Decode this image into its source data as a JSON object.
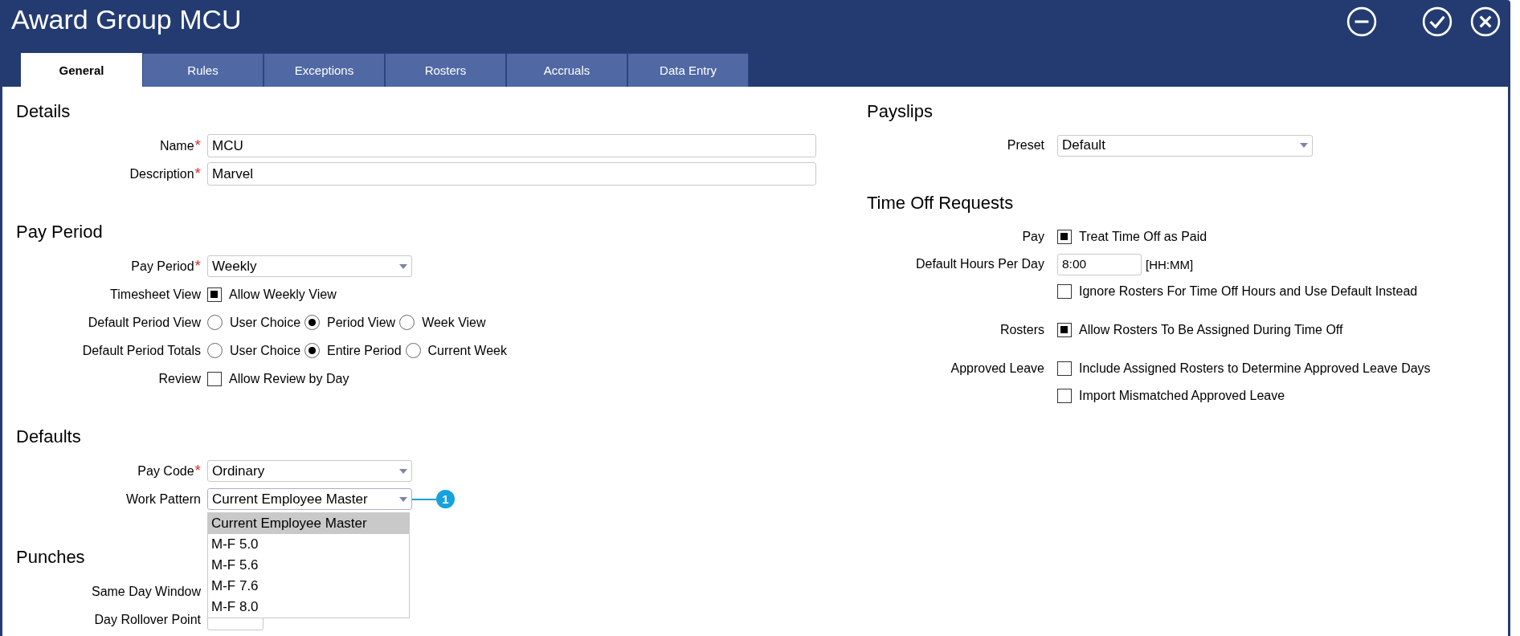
{
  "window": {
    "title": "Award Group MCU",
    "buttons": [
      {
        "kind": "minimize"
      },
      {
        "kind": "confirm"
      },
      {
        "kind": "close"
      }
    ]
  },
  "tabs": [
    {
      "label": "General",
      "selected": true
    },
    {
      "label": "Rules",
      "selected": false
    },
    {
      "label": "Exceptions",
      "selected": false
    },
    {
      "label": "Rosters",
      "selected": false
    },
    {
      "label": "Accruals",
      "selected": false
    },
    {
      "label": "Data Entry",
      "selected": false
    }
  ],
  "left_sections": [
    {
      "heading": "Details",
      "groups": [
        [
          {
            "kind": "text",
            "label": "Name",
            "required_mark": "*",
            "value": "MCU"
          },
          {
            "kind": "text",
            "label": "Description",
            "required_mark": "*",
            "value": "Marvel"
          }
        ]
      ]
    },
    {
      "heading": "Pay Period",
      "groups": [
        [
          {
            "kind": "select",
            "label": "Pay Period",
            "required_mark": "*",
            "value": "Weekly"
          },
          {
            "kind": "checkbox",
            "label": "Timesheet View",
            "options": [
              {
                "text": "Allow Weekly View",
                "checked": true
              }
            ]
          },
          {
            "kind": "radio",
            "label": "Default Period View",
            "options": [
              {
                "text": "User Choice",
                "selected": false
              },
              {
                "text": "Period View",
                "selected": true
              },
              {
                "text": "Week View",
                "selected": false
              }
            ]
          },
          {
            "kind": "radio",
            "label": "Default Period Totals",
            "options": [
              {
                "text": "User Choice",
                "selected": false
              },
              {
                "text": "Entire Period",
                "selected": true
              },
              {
                "text": "Current Week",
                "selected": false
              }
            ]
          },
          {
            "kind": "checkbox",
            "label": "Review",
            "options": [
              {
                "text": "Allow Review by Day",
                "checked": false
              }
            ]
          }
        ]
      ]
    },
    {
      "heading": "Defaults",
      "groups": [
        [
          {
            "kind": "select",
            "label": "Pay Code",
            "required_mark": "*",
            "value": "Ordinary"
          },
          {
            "kind": "select",
            "label": "Work Pattern",
            "value": "Current Employee Master",
            "expanded": true,
            "callout": "1",
            "options": [
              {
                "text": "Current Employee Master",
                "selected": true
              },
              {
                "text": "M-F 5.0",
                "selected": false
              },
              {
                "text": "M-F 5.6",
                "selected": false
              },
              {
                "text": "M-F 7.6",
                "selected": false
              },
              {
                "text": "M-F 8.0",
                "selected": false
              }
            ]
          }
        ]
      ]
    },
    {
      "heading": "Punches",
      "groups": [
        [
          {
            "kind": "label",
            "label": "Same Day Window"
          },
          {
            "kind": "time",
            "label": "Day Rollover Point"
          }
        ]
      ]
    }
  ],
  "right_sections": [
    {
      "heading": "Payslips",
      "groups": [
        [
          {
            "kind": "select",
            "label": "Preset",
            "value": "Default"
          }
        ]
      ]
    },
    {
      "heading": "Time Off Requests",
      "groups": [
        [
          {
            "kind": "checkbox",
            "label": "Pay",
            "options": [
              {
                "text": "Treat Time Off as Paid",
                "checked": true
              }
            ]
          },
          {
            "kind": "time",
            "label": "Default Hours Per Day",
            "value": "8:00",
            "unit": "[HH:MM]"
          },
          {
            "kind": "checkbox",
            "options": [
              {
                "text": "Ignore Rosters For Time Off Hours and Use Default Instead",
                "checked": false
              }
            ]
          }
        ],
        [
          {
            "kind": "checkbox",
            "label": "Rosters",
            "options": [
              {
                "text": "Allow Rosters To Be Assigned During Time Off",
                "checked": true
              }
            ]
          }
        ],
        [
          {
            "kind": "checkbox",
            "label": "Approved Leave",
            "options": [
              {
                "text": "Include Assigned Rosters to Determine Approved Leave Days",
                "checked": false
              }
            ]
          },
          {
            "kind": "checkbox",
            "options": [
              {
                "text": "Import Mismatched Approved Leave",
                "checked": false
              }
            ]
          }
        ]
      ]
    }
  ]
}
